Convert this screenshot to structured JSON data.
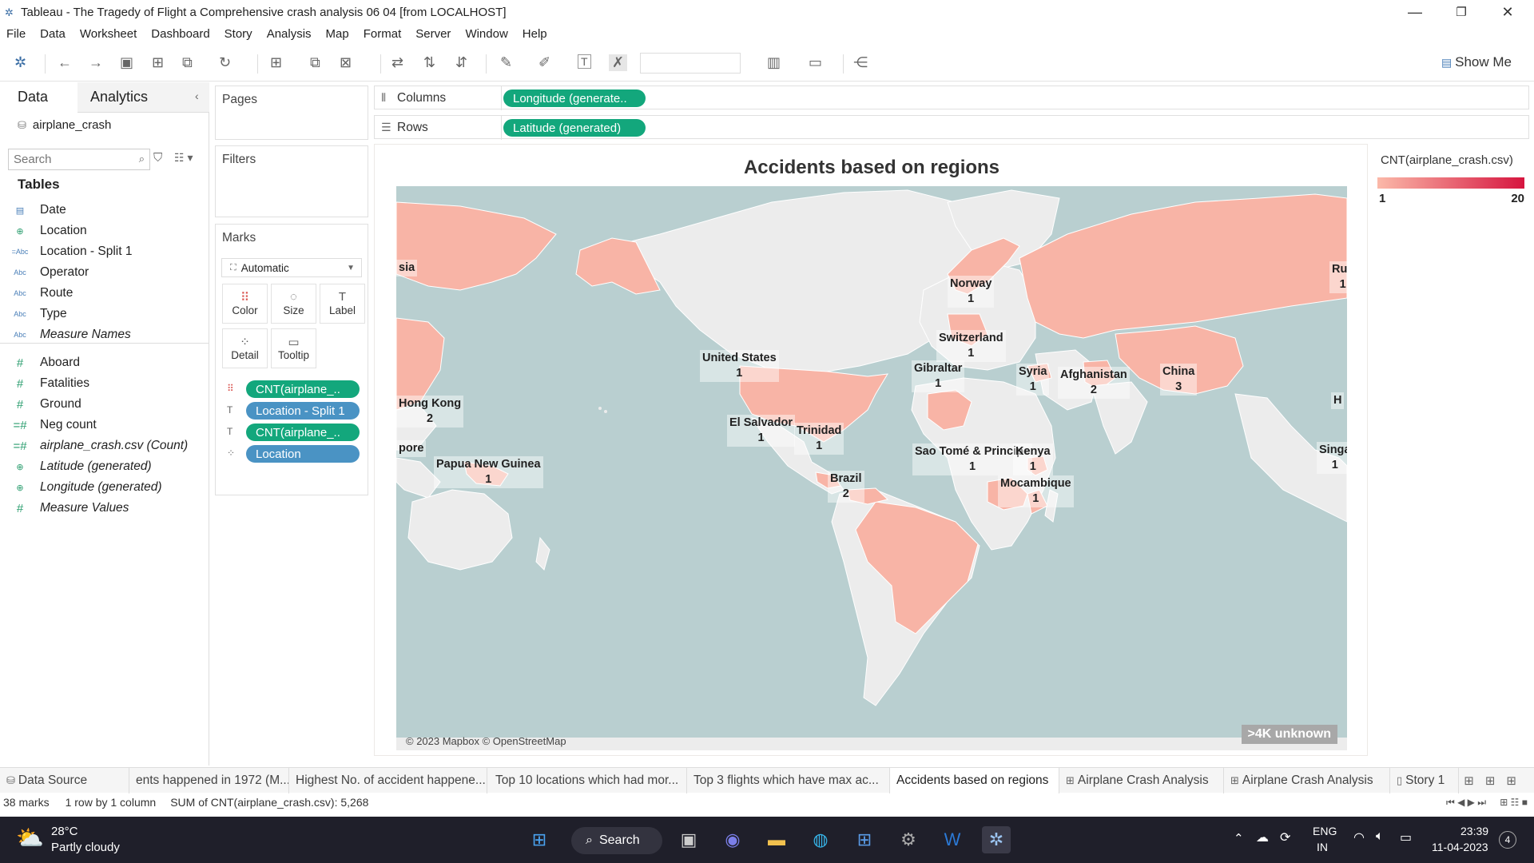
{
  "window": {
    "title": "Tableau - The Tragedy of Flight a Comprehensive crash analysis 06 04 [from LOCALHOST]",
    "minimize": "—",
    "restore": "❐",
    "close": "✕"
  },
  "menu": [
    "File",
    "Data",
    "Worksheet",
    "Dashboard",
    "Story",
    "Analysis",
    "Map",
    "Format",
    "Server",
    "Window",
    "Help"
  ],
  "toolbar": {
    "show_me": "Show Me"
  },
  "data_pane": {
    "tab_data": "Data",
    "tab_analytics": "Analytics",
    "datasource": "airplane_crash",
    "search_placeholder": "Search",
    "tables_heading": "Tables",
    "fields": [
      {
        "name": "Date",
        "icon": "calendar-icon",
        "glyph": "▤",
        "kind": "dim"
      },
      {
        "name": "Location",
        "icon": "globe-icon",
        "glyph": "⊕",
        "kind": "geo"
      },
      {
        "name": "Location - Split 1",
        "icon": "string-icon",
        "glyph": "=Abc",
        "kind": "str"
      },
      {
        "name": "Operator",
        "icon": "string-icon",
        "glyph": "Abc",
        "kind": "str"
      },
      {
        "name": "Route",
        "icon": "string-icon",
        "glyph": "Abc",
        "kind": "str"
      },
      {
        "name": "Type",
        "icon": "string-icon",
        "glyph": "Abc",
        "kind": "str"
      },
      {
        "name": "Measure Names",
        "icon": "string-icon",
        "glyph": "Abc",
        "kind": "str",
        "italic": true
      },
      {
        "name": "Aboard",
        "icon": "measure-icon",
        "glyph": "#",
        "kind": "meas"
      },
      {
        "name": "Fatalities",
        "icon": "measure-icon",
        "glyph": "#",
        "kind": "meas"
      },
      {
        "name": "Ground",
        "icon": "measure-icon",
        "glyph": "#",
        "kind": "meas"
      },
      {
        "name": "Neg count",
        "icon": "measure-icon",
        "glyph": "=#",
        "kind": "meas"
      },
      {
        "name": "airplane_crash.csv (Count)",
        "icon": "measure-icon",
        "glyph": "=#",
        "kind": "meas",
        "italic": true
      },
      {
        "name": "Latitude (generated)",
        "icon": "globe-icon",
        "glyph": "⊕",
        "kind": "geo",
        "italic": true
      },
      {
        "name": "Longitude (generated)",
        "icon": "globe-icon",
        "glyph": "⊕",
        "kind": "geo",
        "italic": true
      },
      {
        "name": "Measure Values",
        "icon": "measure-icon",
        "glyph": "#",
        "kind": "meas",
        "italic": true
      }
    ]
  },
  "shelves": {
    "pages": "Pages",
    "filters": "Filters",
    "marks": "Marks",
    "marks_type": "Automatic",
    "columns_label": "Columns",
    "rows_label": "Rows",
    "columns_pill": "Longitude (generate..",
    "rows_pill": "Latitude (generated)",
    "mark_buttons": [
      {
        "label": "Color",
        "icon": "color-icon",
        "glyph": "⠿"
      },
      {
        "label": "Size",
        "icon": "size-icon",
        "glyph": "◌"
      },
      {
        "label": "Label",
        "icon": "label-icon",
        "glyph": "T"
      },
      {
        "label": "Detail",
        "icon": "detail-icon",
        "glyph": "⁘"
      },
      {
        "label": "Tooltip",
        "icon": "tooltip-icon",
        "glyph": "▭"
      }
    ],
    "mark_pills": [
      {
        "text": "CNT(airplane_..",
        "icon": "color-icon",
        "glyph": "⠿",
        "color": "green"
      },
      {
        "text": "Location - Split 1",
        "icon": "label-icon",
        "glyph": "T",
        "color": "blue"
      },
      {
        "text": "CNT(airplane_..",
        "icon": "label-icon",
        "glyph": "T",
        "color": "green"
      },
      {
        "text": "Location",
        "icon": "detail-icon",
        "glyph": "⁘",
        "color": "blue"
      }
    ]
  },
  "map": {
    "title": "Accidents based on regions",
    "attribution": "© 2023 Mapbox © OpenStreetMap",
    "unknown": ">4K unknown",
    "labels": [
      {
        "name": "sia",
        "count": ""
      },
      {
        "name": "Rus",
        "count": "1"
      },
      {
        "name": "Norway",
        "count": "1"
      },
      {
        "name": "Switzerland",
        "count": "1"
      },
      {
        "name": "United States",
        "count": "1"
      },
      {
        "name": "Gibraltar",
        "count": "1"
      },
      {
        "name": "Syria",
        "count": "1"
      },
      {
        "name": "Afghanistan",
        "count": "2"
      },
      {
        "name": "China",
        "count": "3"
      },
      {
        "name": "H",
        "count": ""
      },
      {
        "name": "Hong Kong",
        "count": "2"
      },
      {
        "name": "El Salvador",
        "count": "1"
      },
      {
        "name": "Trinidad",
        "count": "1"
      },
      {
        "name": "pore",
        "count": ""
      },
      {
        "name": "Sao Tomé & Principe",
        "count": "1"
      },
      {
        "name": "Kenya",
        "count": "1"
      },
      {
        "name": "Singa",
        "count": "1"
      },
      {
        "name": "Papua New Guinea",
        "count": "1"
      },
      {
        "name": "Brazil",
        "count": "2"
      },
      {
        "name": "Mocambique",
        "count": "1"
      }
    ]
  },
  "legend": {
    "title": "CNT(airplane_crash.csv)",
    "min": "1",
    "max": "20",
    "color_low": "#fbb9a9",
    "color_high": "#d6153f"
  },
  "sheet_tabs": [
    {
      "label": "Data Source",
      "icon": "datasource-icon"
    },
    {
      "label": "ents happened in 1972 (M..."
    },
    {
      "label": "Highest No. of accident happene..."
    },
    {
      "label": "Top 10 locations which had mor..."
    },
    {
      "label": "Top 3 flights which have max ac..."
    },
    {
      "label": "Accidents based on regions",
      "active": true
    },
    {
      "label": "Airplane Crash Analysis",
      "icon": "dashboard-icon"
    },
    {
      "label": "Airplane Crash Analysis",
      "icon": "dashboard-icon"
    },
    {
      "label": "Story 1",
      "icon": "story-icon"
    }
  ],
  "status": {
    "marks": "38 marks",
    "rows_cols": "1 row by 1 column",
    "sum": "SUM of CNT(airplane_crash.csv): 5,268"
  },
  "taskbar": {
    "weather_temp": "28°C",
    "weather_desc": "Partly cloudy",
    "search": "Search",
    "lang1": "ENG",
    "lang2": "IN",
    "time": "23:39",
    "date": "11-04-2023",
    "notif": "4"
  }
}
